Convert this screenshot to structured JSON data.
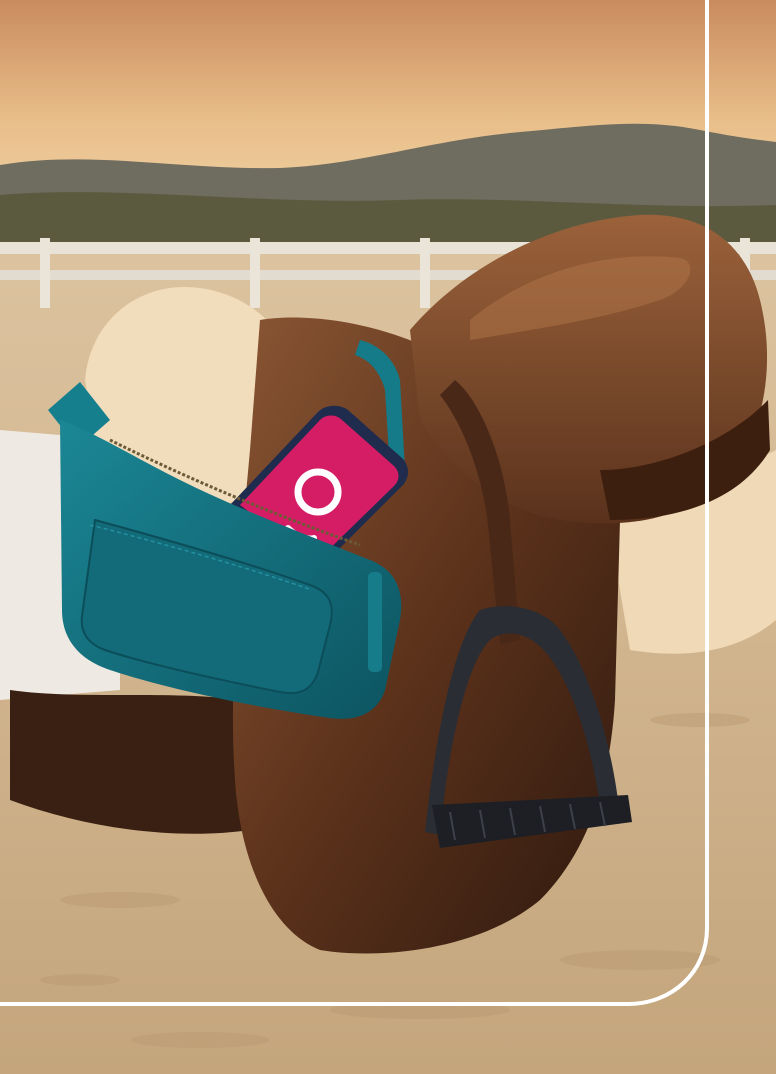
{
  "colors": {
    "accent": "#0a9a91",
    "frame": "#ffffff",
    "phone_screen": "#d51d66",
    "phone_logo": "#ffffff",
    "bag": "#146f7d",
    "saddle": "#5a321c",
    "fleece": "#f1dcbc",
    "sand": "#cfb590",
    "sky_top": "#d6a06b",
    "sky_bottom": "#f2d7a8"
  },
  "icons": {
    "phone_logo": "pink-circle-smile-logo"
  }
}
